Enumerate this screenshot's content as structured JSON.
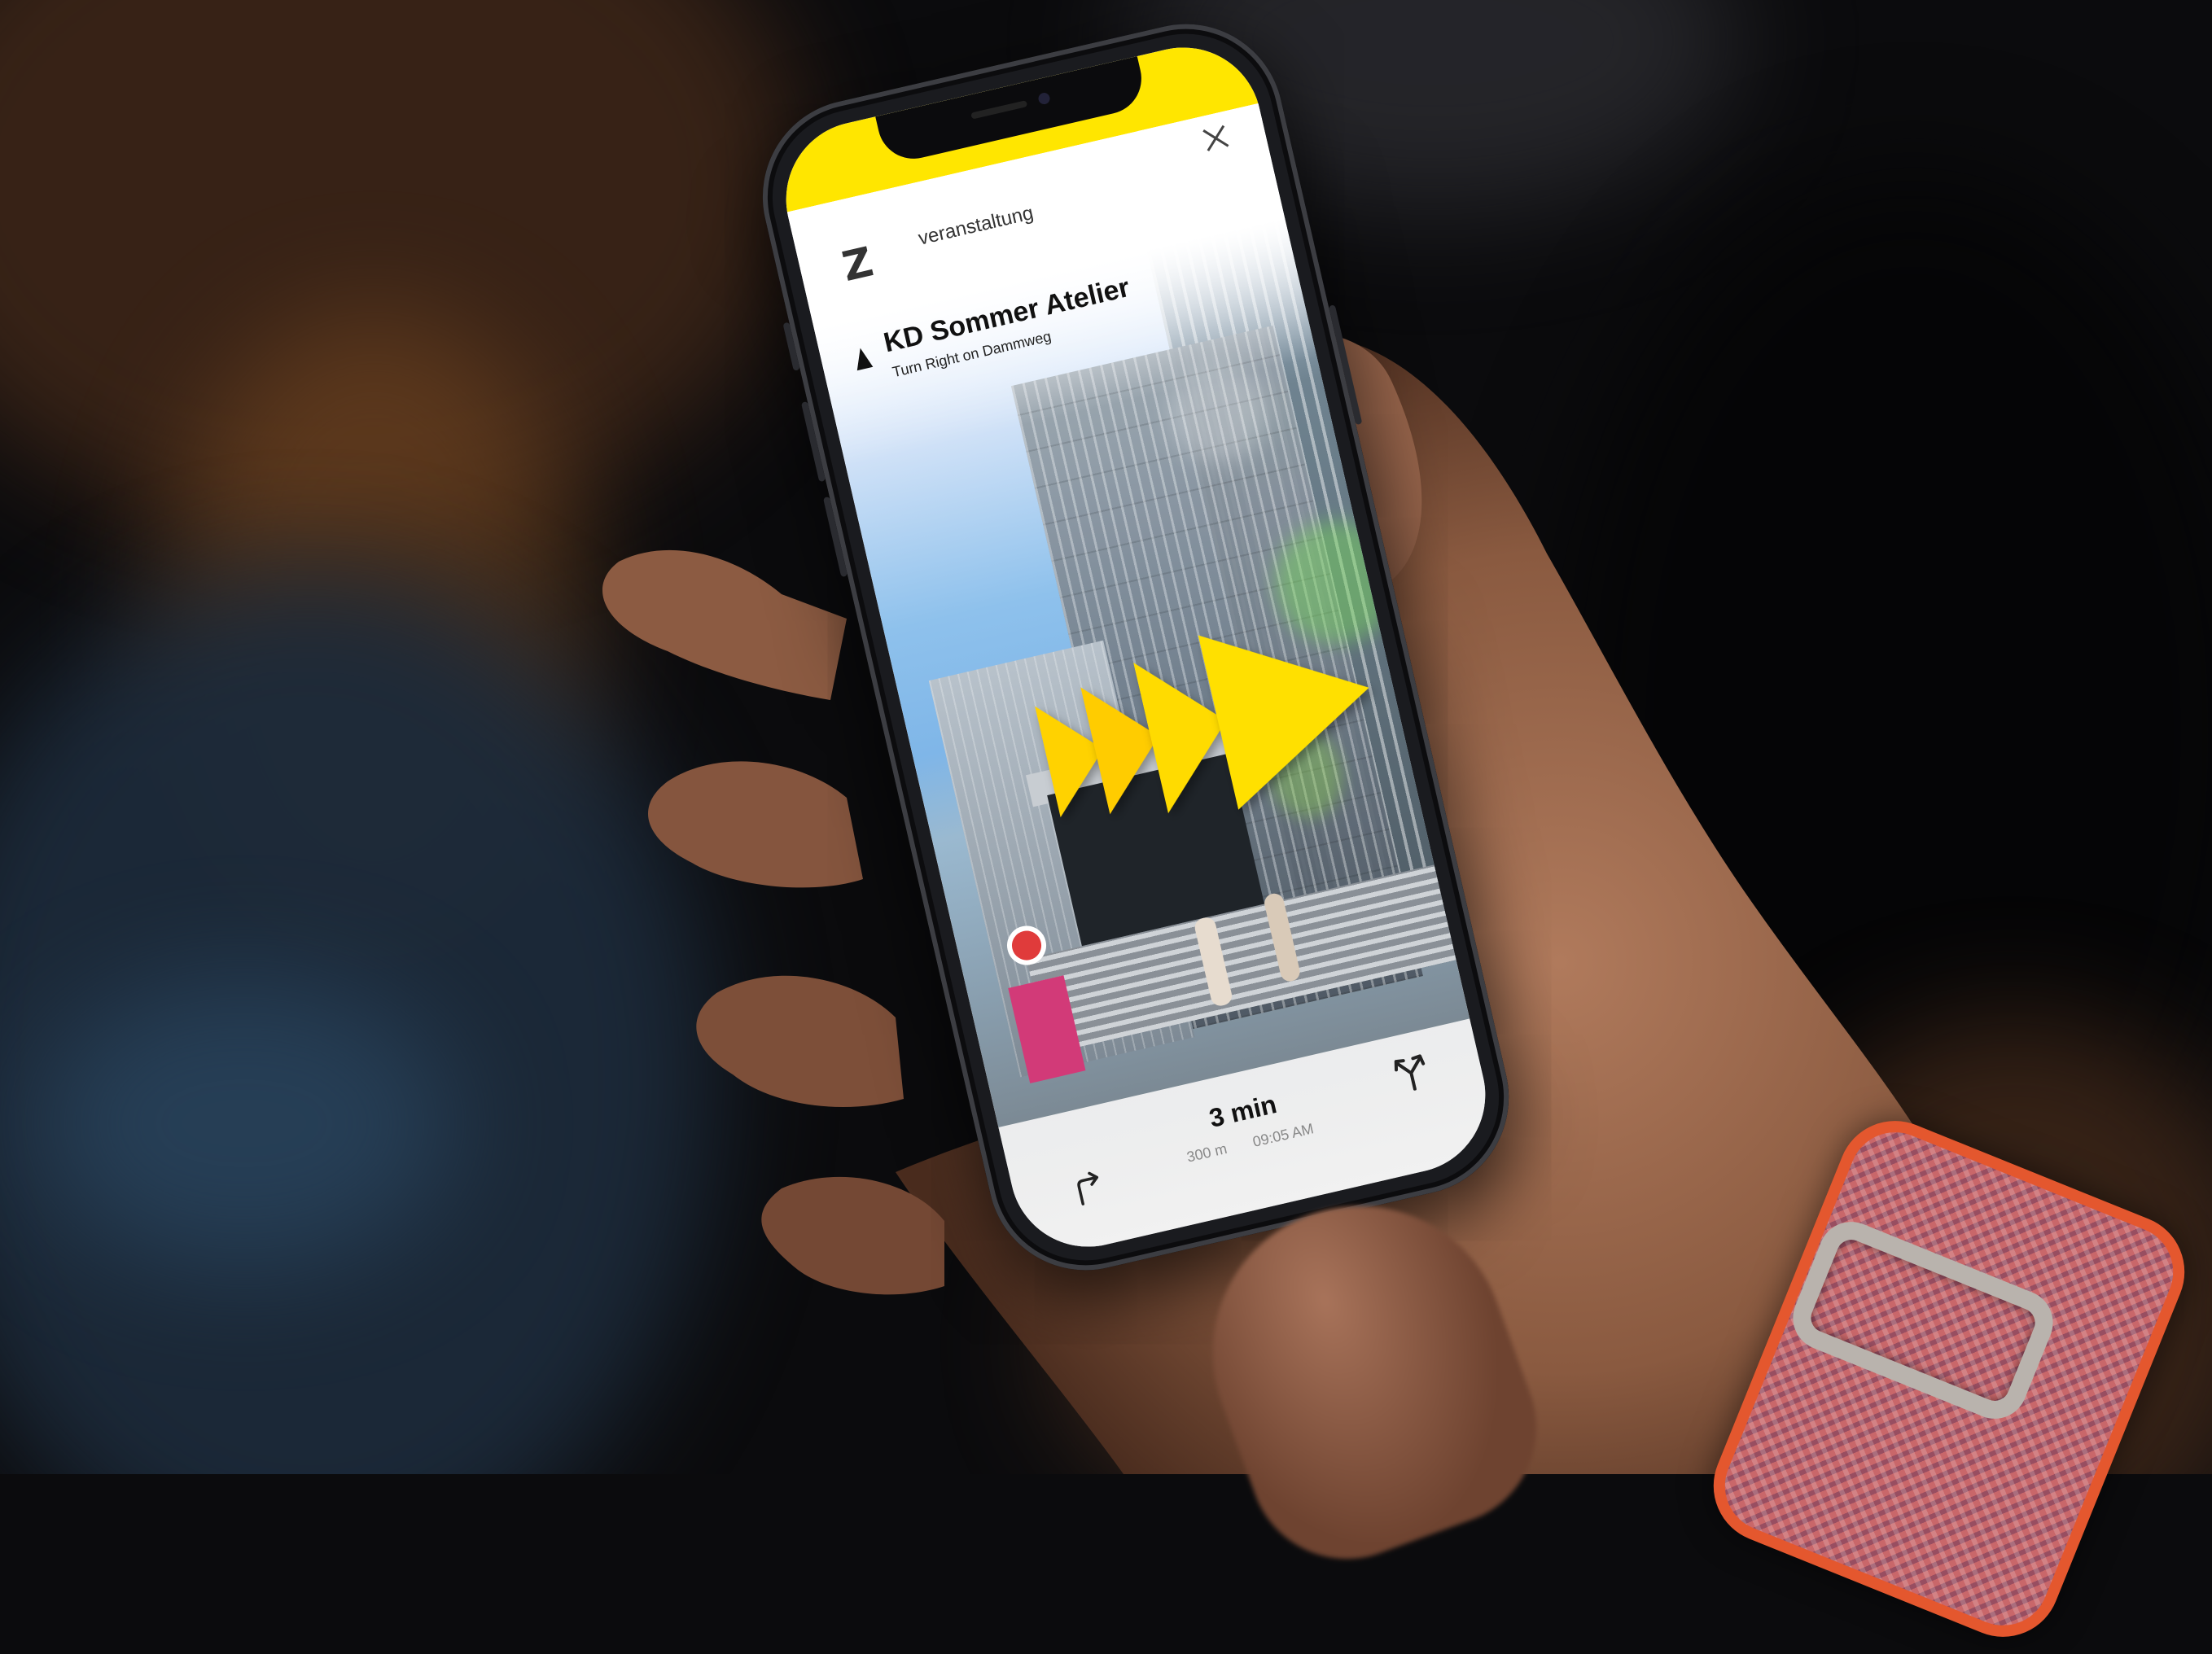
{
  "app": {
    "logo_text": "Z",
    "category": "veranstaltung",
    "close_icon": "close-icon",
    "accent_color": "#ffe600"
  },
  "navigation": {
    "destination": "KD Sommer Atelier",
    "instruction": "Turn Right on Dammweg",
    "direction_icon": "navigation-arrow-icon"
  },
  "ar_overlay": {
    "chevron_count": 4,
    "chevron_color": "#ffd200"
  },
  "bottom_bar": {
    "eta": "3 min",
    "distance": "300 m",
    "arrival_time": "09:05 AM",
    "left_icon": "turn-right-icon",
    "right_icon": "route-fork-icon"
  }
}
